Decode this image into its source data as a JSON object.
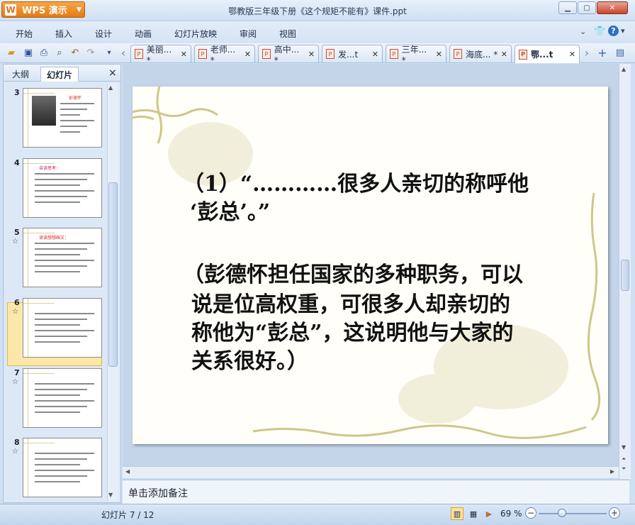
{
  "window": {
    "app_label": "WPS 演示",
    "title": "鄂教版三年级下册《这个规矩不能有》课件.ppt"
  },
  "menu": [
    "开始",
    "插入",
    "设计",
    "动画",
    "幻灯片放映",
    "审阅",
    "视图"
  ],
  "doc_tabs": [
    {
      "label": "美丽... *",
      "active": false
    },
    {
      "label": "老师... *",
      "active": false
    },
    {
      "label": "高中... *",
      "active": false
    },
    {
      "label": "发...t",
      "active": false
    },
    {
      "label": "三年... *",
      "active": false
    },
    {
      "label": "海底... *",
      "active": false
    },
    {
      "label": "鄂...t",
      "active": true
    }
  ],
  "panel": {
    "tab_outline": "大纲",
    "tab_slides": "幻灯片",
    "close": "×"
  },
  "thumbnails": [
    {
      "num": "3",
      "star": "",
      "heading": "彭德怀",
      "heading_color": "#d04020"
    },
    {
      "num": "4",
      "star": "",
      "heading": "自读思考：",
      "heading_color": "#d02060"
    },
    {
      "num": "5",
      "star": "☆",
      "heading": "读读想想画文：",
      "heading_color": "#e02020"
    },
    {
      "num": "6",
      "star": "☆",
      "heading": "",
      "heading_color": "#333333"
    },
    {
      "num": "7",
      "star": "☆",
      "heading": "",
      "heading_color": "#333333"
    },
    {
      "num": "8",
      "star": "☆",
      "heading": "",
      "heading_color": "#333333"
    }
  ],
  "slide": {
    "line1": "（1）“…………很多人亲切的称呼他",
    "line2": "‘彭总’。”",
    "line3": "（彭德怀担任国家的多种职务，可以",
    "line4": "说是位高权重，可很多人却亲切的",
    "line5": "称他为“彭总”，这说明他与大家的",
    "line6": "关系很好。）"
  },
  "notes_placeholder": "单击添加备注",
  "status": {
    "slide_indicator": "幻灯片 7 / 12",
    "zoom": "69 %"
  },
  "colors": {
    "accent_orange": "#e57a12",
    "selected_thumb": "#fbe8a8",
    "vine": "#cfc68a"
  }
}
